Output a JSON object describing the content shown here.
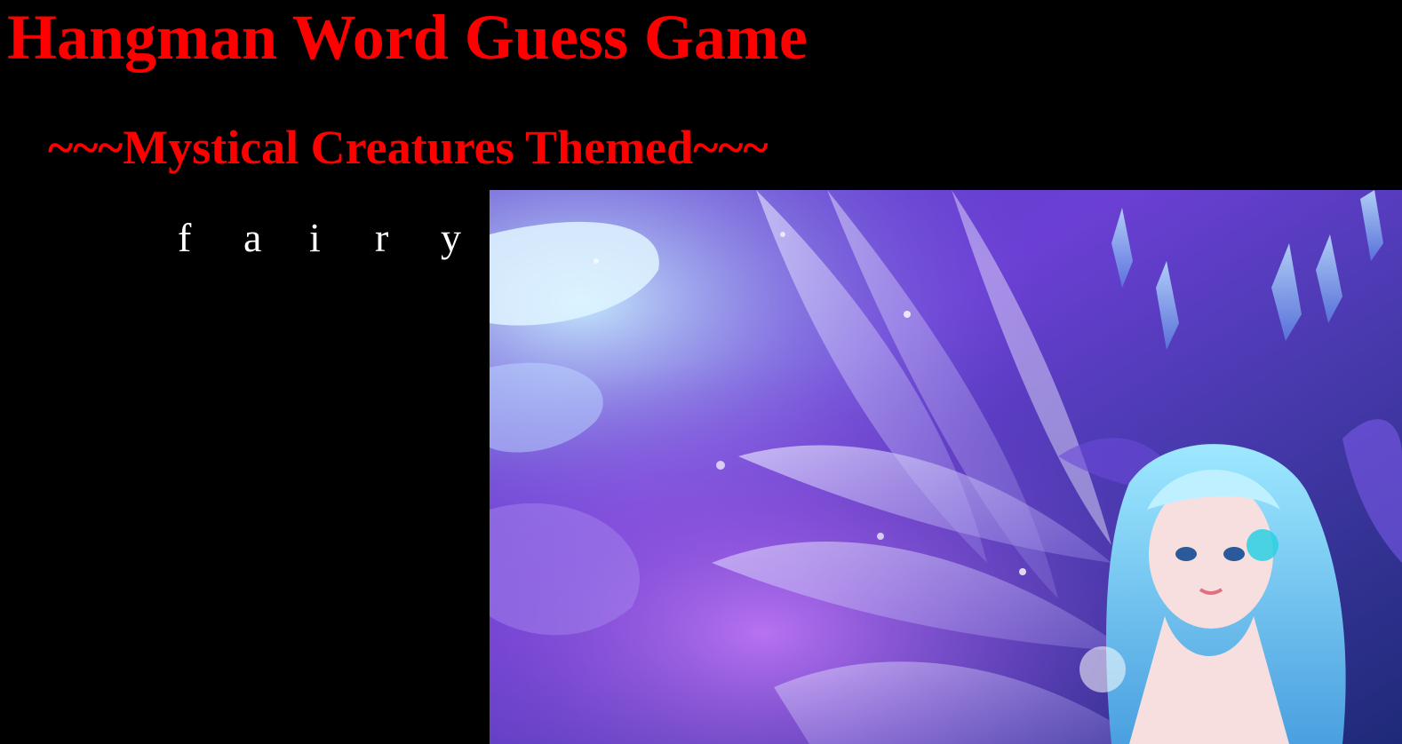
{
  "game": {
    "title": "Hangman Word Guess Game",
    "subtitle": "~~~Mystical Creatures Themed~~~",
    "word_letters": [
      "f",
      "a",
      "i",
      "r",
      "y"
    ]
  },
  "image": {
    "icon": "fairy-illustration"
  },
  "colors": {
    "background": "#000000",
    "heading": "#ff0000",
    "letters": "#ffffff"
  }
}
